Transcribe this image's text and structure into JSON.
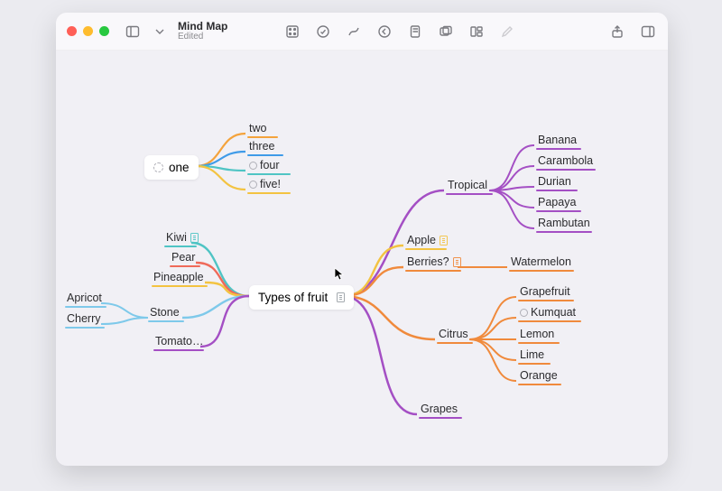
{
  "window": {
    "title": "Mind Map",
    "subtitle": "Edited"
  },
  "colors": {
    "orange": "#f4a33c",
    "blue": "#3f9be8",
    "cyan": "#4fc4c4",
    "red": "#ef6a5a",
    "yellow": "#f3c341",
    "lightblue": "#7ec9ea",
    "purple": "#a44fc4",
    "orange2": "#f08a3c",
    "darkorange": "#e07a2f"
  },
  "rootNodes": {
    "one": "one",
    "types": "Types of fruit"
  },
  "mindmap": {
    "one_children": [
      {
        "label": "two",
        "color": "#f4a33c"
      },
      {
        "label": "three",
        "color": "#3f9be8"
      },
      {
        "label": "four",
        "color": "#4fc4c4",
        "task": true
      },
      {
        "label": "five!",
        "color": "#f3c341",
        "task": true
      }
    ],
    "left": [
      {
        "label": "Kiwi",
        "color": "#4fc4c4",
        "note": true
      },
      {
        "label": "Pear",
        "color": "#ef6a5a"
      },
      {
        "label": "Pineapple",
        "color": "#f3c341"
      },
      {
        "label": "Stone",
        "color": "#7ec9ea",
        "children": [
          {
            "label": "Apricot",
            "color": "#7ec9ea"
          },
          {
            "label": "Cherry",
            "color": "#7ec9ea"
          }
        ]
      },
      {
        "label": "Tomato…",
        "color": "#a44fc4"
      }
    ],
    "right": [
      {
        "label": "Tropical",
        "color": "#a44fc4",
        "children": [
          {
            "label": "Banana",
            "color": "#a44fc4"
          },
          {
            "label": "Carambola",
            "color": "#a44fc4"
          },
          {
            "label": "Durian",
            "color": "#a44fc4"
          },
          {
            "label": "Papaya",
            "color": "#a44fc4"
          },
          {
            "label": "Rambutan",
            "color": "#a44fc4"
          }
        ]
      },
      {
        "label": "Apple",
        "color": "#f3c341",
        "note": true
      },
      {
        "label": "Berries?",
        "color": "#f08a3c",
        "note": true,
        "children": [
          {
            "label": "Watermelon",
            "color": "#f08a3c"
          }
        ]
      },
      {
        "label": "Citrus",
        "color": "#f08a3c",
        "children": [
          {
            "label": "Grapefruit",
            "color": "#f08a3c"
          },
          {
            "label": "Kumquat",
            "color": "#f08a3c",
            "task": true
          },
          {
            "label": "Lemon",
            "color": "#f08a3c"
          },
          {
            "label": "Lime",
            "color": "#f08a3c"
          },
          {
            "label": "Orange",
            "color": "#f08a3c"
          }
        ]
      },
      {
        "label": "Grapes",
        "color": "#a44fc4"
      }
    ]
  }
}
